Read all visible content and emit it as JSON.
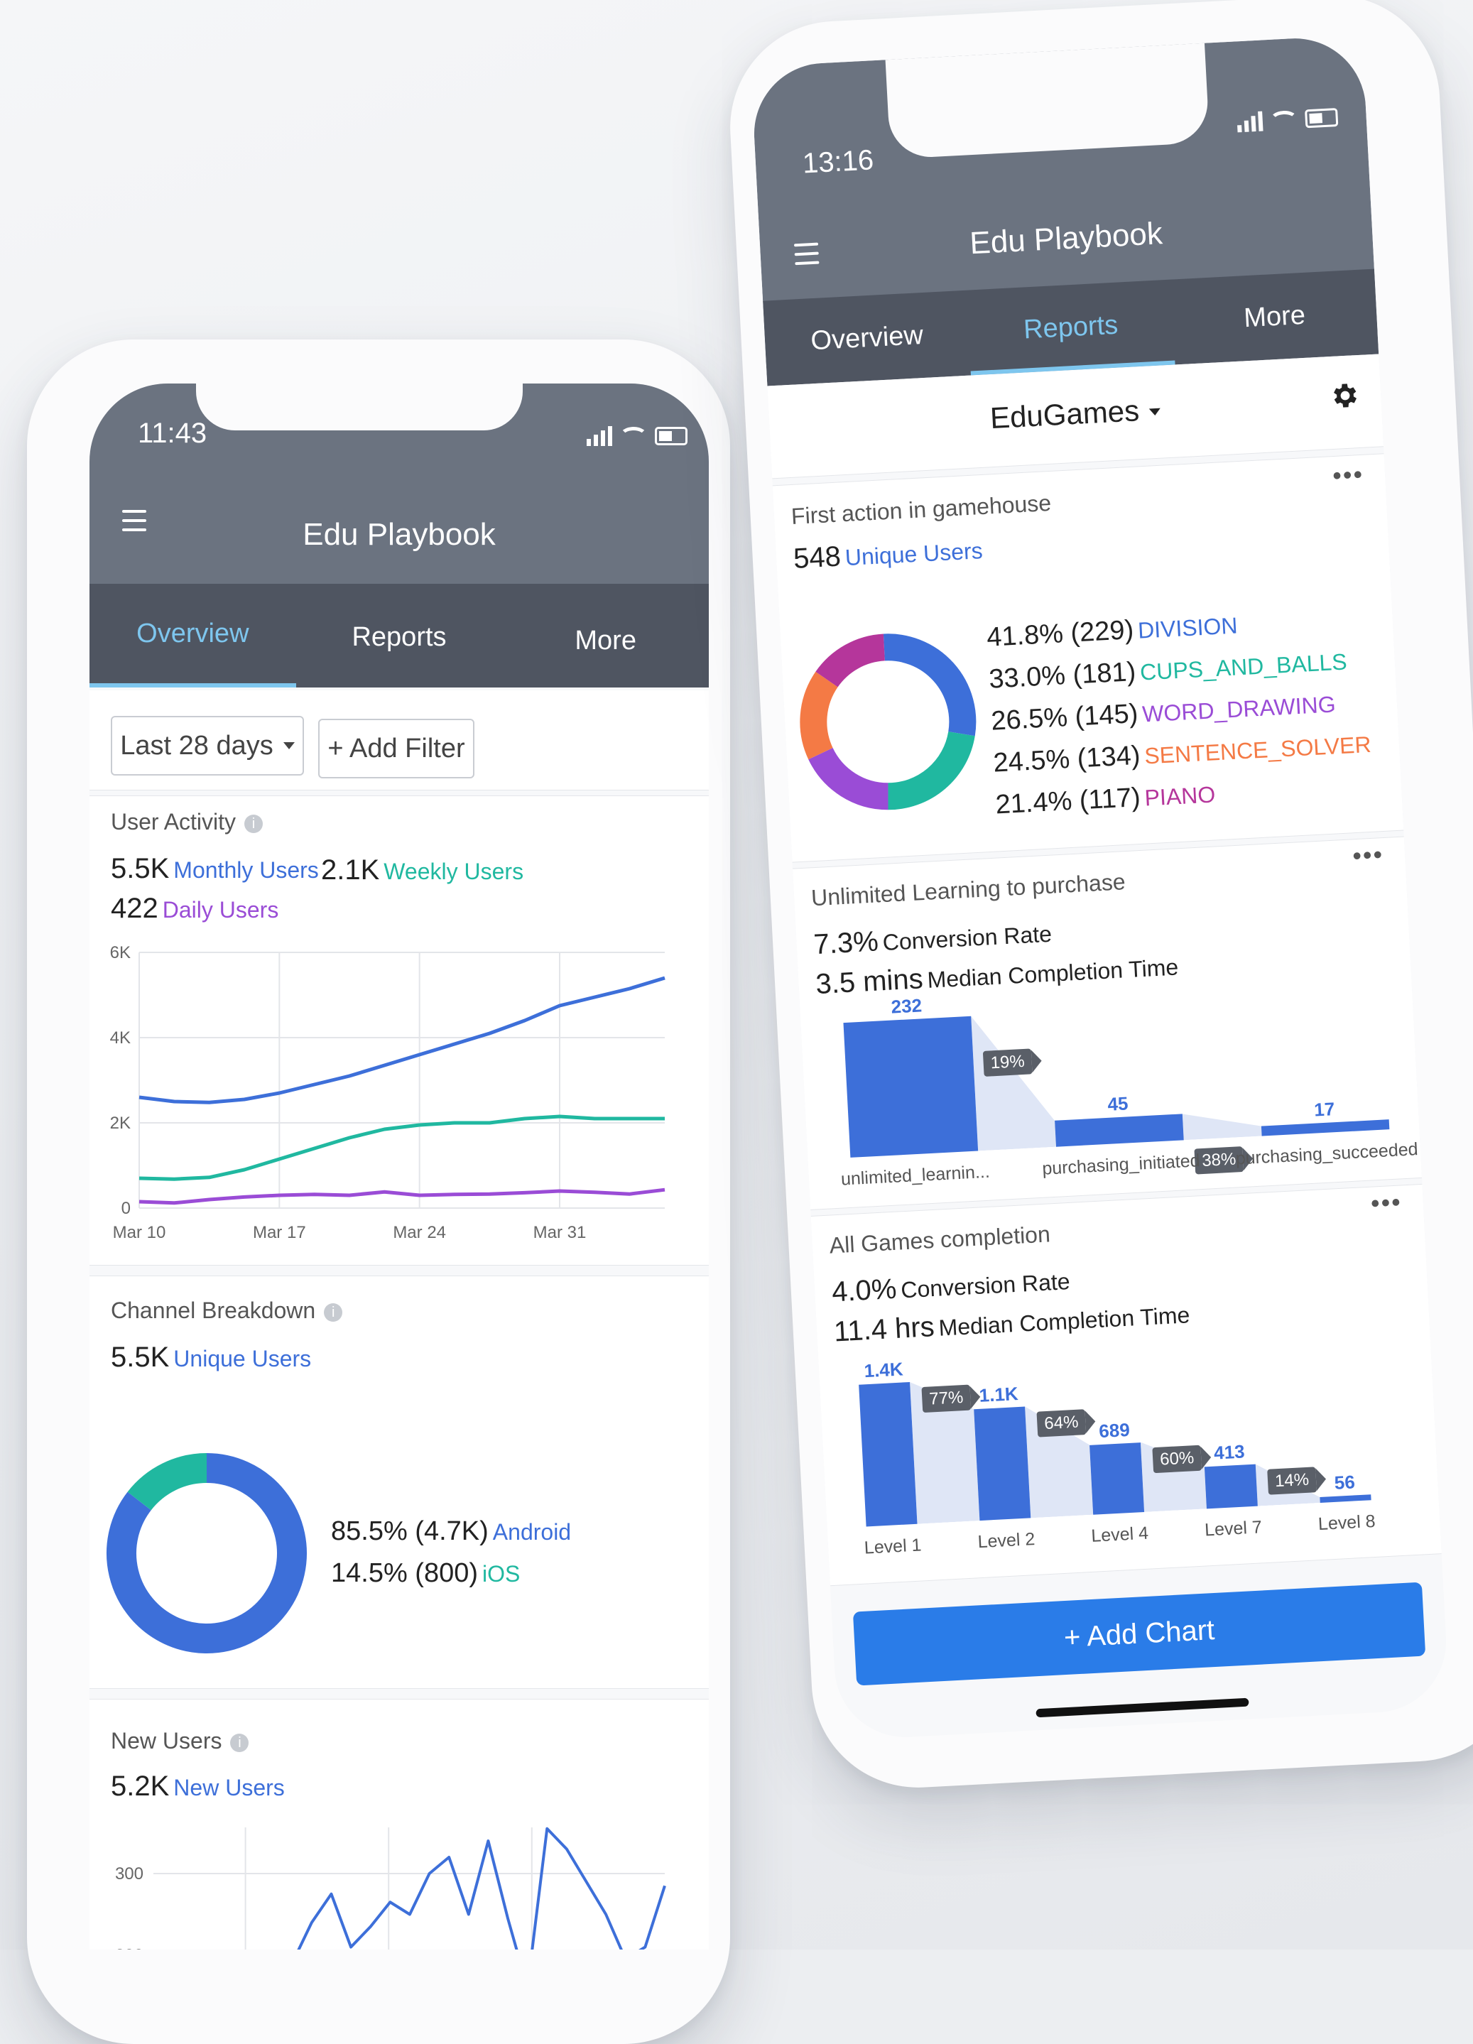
{
  "left_phone": {
    "status_time": "11:43",
    "app_title": "Edu Playbook",
    "tabs": [
      "Overview",
      "Reports",
      "More"
    ],
    "active_tab": "Overview",
    "filters": {
      "date_range": "Last 28 days",
      "add_filter": "+ Add Filter"
    },
    "user_activity": {
      "title": "User Activity",
      "monthly_value": "5.5K",
      "monthly_label": "Monthly Users",
      "weekly_value": "2.1K",
      "weekly_label": "Weekly Users",
      "daily_value": "422",
      "daily_label": "Daily Users",
      "chart_data": {
        "type": "line",
        "x": [
          "Mar 10",
          "Mar 12",
          "Mar 14",
          "Mar 16",
          "Mar 17",
          "Mar 19",
          "Mar 21",
          "Mar 23",
          "Mar 24",
          "Mar 26",
          "Mar 28",
          "Mar 30",
          "Mar 31",
          "Apr 2",
          "Apr 4",
          "Apr 6"
        ],
        "x_tick_labels": [
          "Mar 10",
          "Mar 17",
          "Mar 24",
          "Mar 31"
        ],
        "y_tick_labels": [
          "0",
          "2K",
          "4K",
          "6K"
        ],
        "ylim": [
          0,
          6000
        ],
        "series": [
          {
            "name": "Monthly Users",
            "color": "#3d6fd9",
            "values": [
              2600,
              2500,
              2480,
              2550,
              2700,
              2900,
              3100,
              3350,
              3600,
              3850,
              4100,
              4400,
              4750,
              4950,
              5150,
              5400
            ]
          },
          {
            "name": "Weekly Users",
            "color": "#20b8a0",
            "values": [
              700,
              680,
              720,
              900,
              1150,
              1400,
              1650,
              1850,
              1950,
              2000,
              2000,
              2100,
              2150,
              2100,
              2100,
              2100
            ]
          },
          {
            "name": "Daily Users",
            "color": "#9a4cd6",
            "values": [
              150,
              120,
              200,
              260,
              300,
              320,
              300,
              380,
              300,
              320,
              330,
              360,
              400,
              370,
              330,
              430
            ]
          }
        ]
      }
    },
    "channel_breakdown": {
      "title": "Channel Breakdown",
      "value": "5.5K",
      "label": "Unique Users",
      "chart_data": {
        "type": "pie",
        "slices": [
          {
            "name": "Android",
            "percent": 85.5,
            "count": "4.7K",
            "color": "#3d6fd9"
          },
          {
            "name": "iOS",
            "percent": 14.5,
            "count": "800",
            "color": "#20b8a0"
          }
        ]
      },
      "legend": [
        {
          "text": "85.5% (4.7K)",
          "name": "Android"
        },
        {
          "text": "14.5% (800)",
          "name": "iOS"
        }
      ]
    },
    "new_users": {
      "title": "New Users",
      "value": "5.2K",
      "label": "New Users",
      "chart_data": {
        "type": "line",
        "y_tick_labels": [
          "200",
          "300"
        ],
        "series": [
          {
            "name": "New Users",
            "color": "#3d6fd9",
            "values": [
              140,
              165,
              190,
              240,
              275,
              210,
              235,
              265,
              250,
              300,
              320,
              250,
              340,
              245,
              160,
              355,
              330,
              290,
              250,
              195,
              210,
              285
            ]
          }
        ]
      }
    }
  },
  "right_phone": {
    "status_time": "13:16",
    "app_title": "Edu Playbook",
    "tabs": [
      "Overview",
      "Reports",
      "More"
    ],
    "active_tab": "Reports",
    "project": "EduGames",
    "first_action": {
      "title": "First action in gamehouse",
      "value": "548",
      "label": "Unique Users",
      "chart_data": {
        "type": "pie",
        "slices": [
          {
            "name": "DIVISION",
            "percent": 41.8,
            "count": 229,
            "color": "#3d6fd9"
          },
          {
            "name": "CUPS_AND_BALLS",
            "percent": 33.0,
            "count": 181,
            "color": "#20b8a0"
          },
          {
            "name": "WORD_DRAWING",
            "percent": 26.5,
            "count": 145,
            "color": "#9a4cd6"
          },
          {
            "name": "SENTENCE_SOLVER",
            "percent": 24.5,
            "count": 134,
            "color": "#f47a45"
          },
          {
            "name": "PIANO",
            "percent": 21.4,
            "count": 117,
            "color": "#b5369b"
          }
        ]
      },
      "legend": [
        {
          "text": "41.8% (229)",
          "name": "DIVISION",
          "cls": "c-blue"
        },
        {
          "text": "33.0% (181)",
          "name": "CUPS_AND_BALLS",
          "cls": "c-teal"
        },
        {
          "text": "26.5% (145)",
          "name": "WORD_DRAWING",
          "cls": "c-purple"
        },
        {
          "text": "24.5% (134)",
          "name": "SENTENCE_SOLVER",
          "cls": "c-orange"
        },
        {
          "text": "21.4% (117)",
          "name": "PIANO",
          "cls": "c-magenta"
        }
      ]
    },
    "unlimited_learning": {
      "title": "Unlimited Learning to purchase",
      "conversion_value": "7.3%",
      "conversion_label": "Conversion Rate",
      "median_value": "3.5 mins",
      "median_label": "Median Completion Time",
      "chart_data": {
        "type": "bar",
        "categories": [
          "unlimited_learnin...",
          "purchasing_initiated",
          "purchasing_succeeded"
        ],
        "values": [
          232,
          45,
          17
        ],
        "step_conversions": [
          "19%",
          "38%"
        ]
      }
    },
    "all_games": {
      "title": "All Games completion",
      "conversion_value": "4.0%",
      "conversion_label": "Conversion Rate",
      "median_value": "11.4 hrs",
      "median_label": "Median Completion Time",
      "chart_data": {
        "type": "bar",
        "categories": [
          "Level 1",
          "Level 2",
          "Level 4",
          "Level 7",
          "Level 8"
        ],
        "values": [
          1400,
          1100,
          689,
          413,
          56
        ],
        "value_labels": [
          "1.4K",
          "1.1K",
          "689",
          "413",
          "56"
        ],
        "step_conversions": [
          "77%",
          "64%",
          "60%",
          "14%"
        ]
      }
    },
    "add_chart": "+ Add Chart",
    "more_dots": "•••"
  }
}
